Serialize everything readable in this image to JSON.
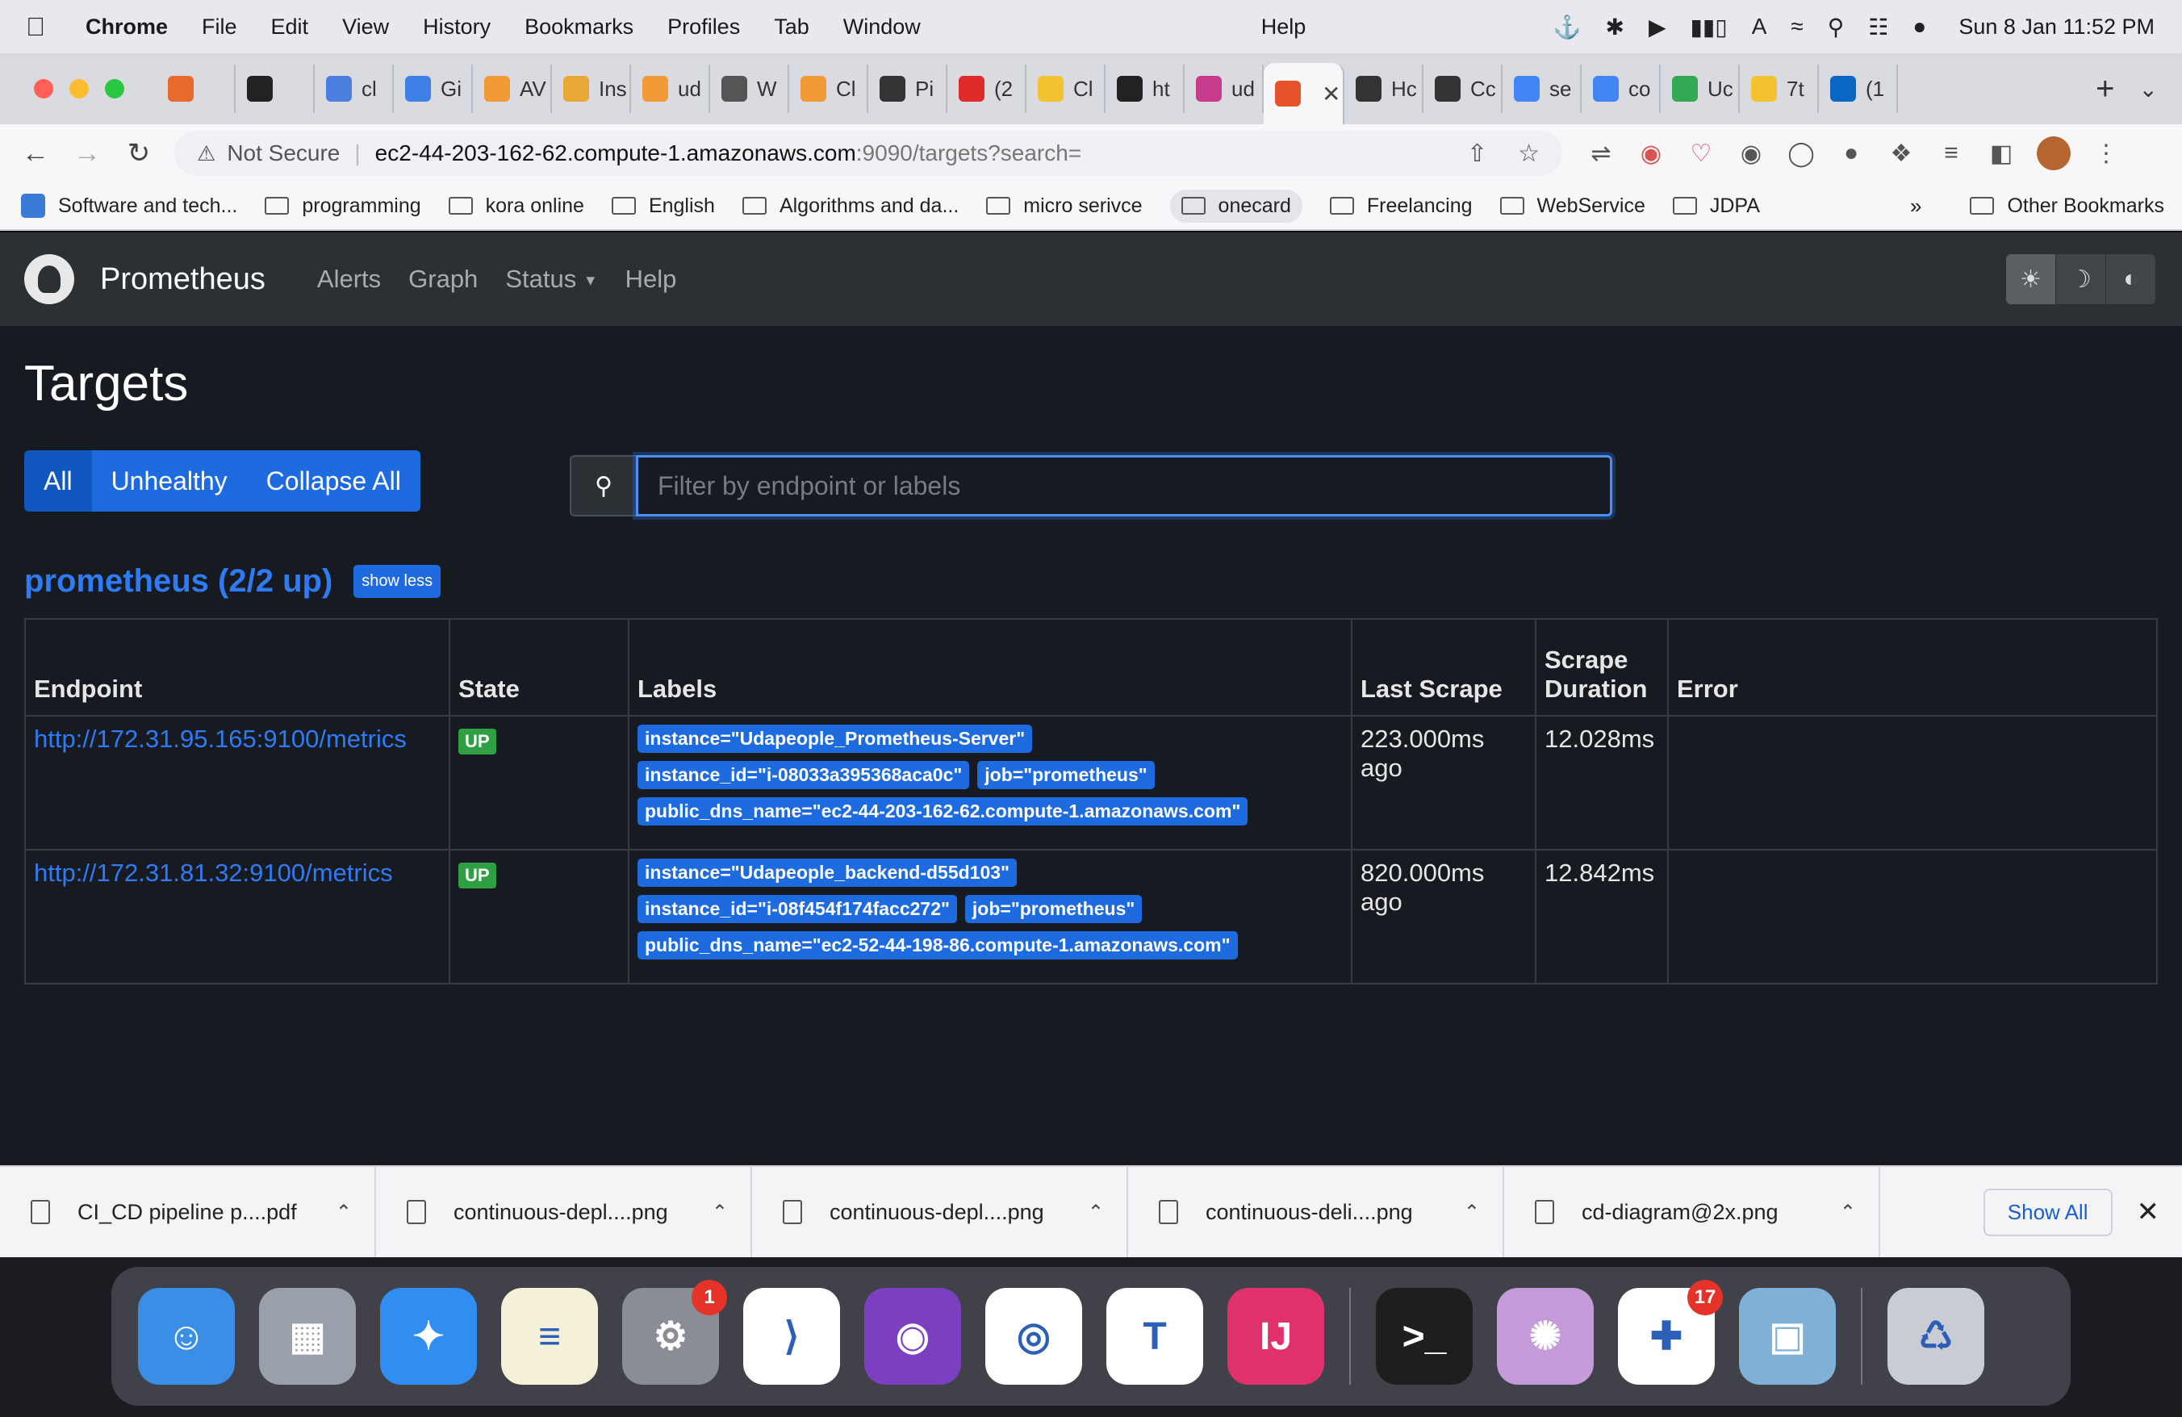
{
  "menubar": {
    "app": "Chrome",
    "items": [
      "File",
      "Edit",
      "View",
      "History",
      "Bookmarks",
      "Profiles",
      "Tab",
      "Window",
      "Help"
    ],
    "clock": "Sun 8 Jan  11:52 PM"
  },
  "tabs": [
    {
      "label": "",
      "color": "#e8692c"
    },
    {
      "label": "",
      "color": "#222222"
    },
    {
      "label": "cl",
      "color": "#4a7fe0"
    },
    {
      "label": "Gi",
      "color": "#3d7fe6"
    },
    {
      "label": "AV",
      "color": "#f29a38"
    },
    {
      "label": "Ins",
      "color": "#e8a838"
    },
    {
      "label": "ud",
      "color": "#f29a38"
    },
    {
      "label": "W",
      "color": "#555555"
    },
    {
      "label": "Cl",
      "color": "#f29a38"
    },
    {
      "label": "Pi",
      "color": "#333333"
    },
    {
      "label": "(2",
      "color": "#e02b2b"
    },
    {
      "label": "Cl",
      "color": "#f2c230"
    },
    {
      "label": "ht",
      "color": "#222222"
    },
    {
      "label": "ud",
      "color": "#c63b8c"
    },
    {
      "label": "",
      "color": "#e6522c",
      "active": true
    },
    {
      "label": "Hc",
      "color": "#333333"
    },
    {
      "label": "Cc",
      "color": "#333333"
    },
    {
      "label": "se",
      "color": "#4285f4"
    },
    {
      "label": "co",
      "color": "#4285f4"
    },
    {
      "label": "Uc",
      "color": "#34a853"
    },
    {
      "label": "7t",
      "color": "#f2c230"
    },
    {
      "label": "(1",
      "color": "#0a66c2"
    }
  ],
  "address": {
    "security": "Not Secure",
    "host": "ec2-44-203-162-62.compute-1.amazonaws.com",
    "path": ":9090/targets?search="
  },
  "bookmarks": {
    "items": [
      "Software and tech...",
      "programming",
      "kora online",
      "English",
      "Algorithms and da...",
      "micro serivce",
      "onecard",
      "Freelancing",
      "WebService",
      "JDPA"
    ],
    "more": "»",
    "other": "Other Bookmarks"
  },
  "prometheus": {
    "brand": "Prometheus",
    "nav": [
      "Alerts",
      "Graph",
      "Status",
      "Help"
    ],
    "title": "Targets",
    "filters": [
      "All",
      "Unhealthy",
      "Collapse All"
    ],
    "search_placeholder": "Filter by endpoint or labels",
    "group_title": "prometheus (2/2 up)",
    "show_less": "show less",
    "columns": [
      "Endpoint",
      "State",
      "Labels",
      "Last Scrape",
      "Scrape Duration",
      "Error"
    ],
    "rows": [
      {
        "endpoint": "http://172.31.95.165:9100/metrics",
        "state": "UP",
        "labels": [
          "instance=\"Udapeople_Prometheus-Server\"",
          "instance_id=\"i-08033a395368aca0c\"",
          "job=\"prometheus\"",
          "public_dns_name=\"ec2-44-203-162-62.compute-1.amazonaws.com\""
        ],
        "last_scrape": "223.000ms ago",
        "duration": "12.028ms",
        "error": ""
      },
      {
        "endpoint": "http://172.31.81.32:9100/metrics",
        "state": "UP",
        "labels": [
          "instance=\"Udapeople_backend-d55d103\"",
          "instance_id=\"i-08f454f174facc272\"",
          "job=\"prometheus\"",
          "public_dns_name=\"ec2-52-44-198-86.compute-1.amazonaws.com\""
        ],
        "last_scrape": "820.000ms ago",
        "duration": "12.842ms",
        "error": ""
      }
    ]
  },
  "downloads": {
    "files": [
      "CI_CD pipeline p....pdf",
      "continuous-depl....png",
      "continuous-depl....png",
      "continuous-deli....png",
      "cd-diagram@2x.png"
    ],
    "show_all": "Show All"
  },
  "dock": {
    "apps": [
      {
        "name": "finder",
        "color": "#3a8ee6",
        "glyph": "☺"
      },
      {
        "name": "launchpad",
        "color": "#9aa0aa",
        "glyph": "▦"
      },
      {
        "name": "safari",
        "color": "#2f8ef0",
        "glyph": "✦"
      },
      {
        "name": "notes",
        "color": "#f5f0d8",
        "glyph": "≡"
      },
      {
        "name": "system-settings",
        "color": "#8a8d93",
        "glyph": "⚙",
        "badge": "1"
      },
      {
        "name": "vscode",
        "color": "#ffffff",
        "glyph": "⟩"
      },
      {
        "name": "github-desktop",
        "color": "#7b3fbf",
        "glyph": "◉"
      },
      {
        "name": "chrome",
        "color": "#ffffff",
        "glyph": "◎"
      },
      {
        "name": "teams",
        "color": "#ffffff",
        "glyph": "T"
      },
      {
        "name": "intellij",
        "color": "#e0316b",
        "glyph": "IJ"
      },
      {
        "name": "terminal",
        "color": "#1e1e1e",
        "glyph": ">_"
      },
      {
        "name": "octopus",
        "color": "#c49ad8",
        "glyph": "✺"
      },
      {
        "name": "slack",
        "color": "#ffffff",
        "glyph": "✚",
        "badge": "17"
      },
      {
        "name": "preview",
        "color": "#7fb0d8",
        "glyph": "▣"
      },
      {
        "name": "trash",
        "color": "#c9ccd2",
        "glyph": "♺"
      }
    ]
  }
}
